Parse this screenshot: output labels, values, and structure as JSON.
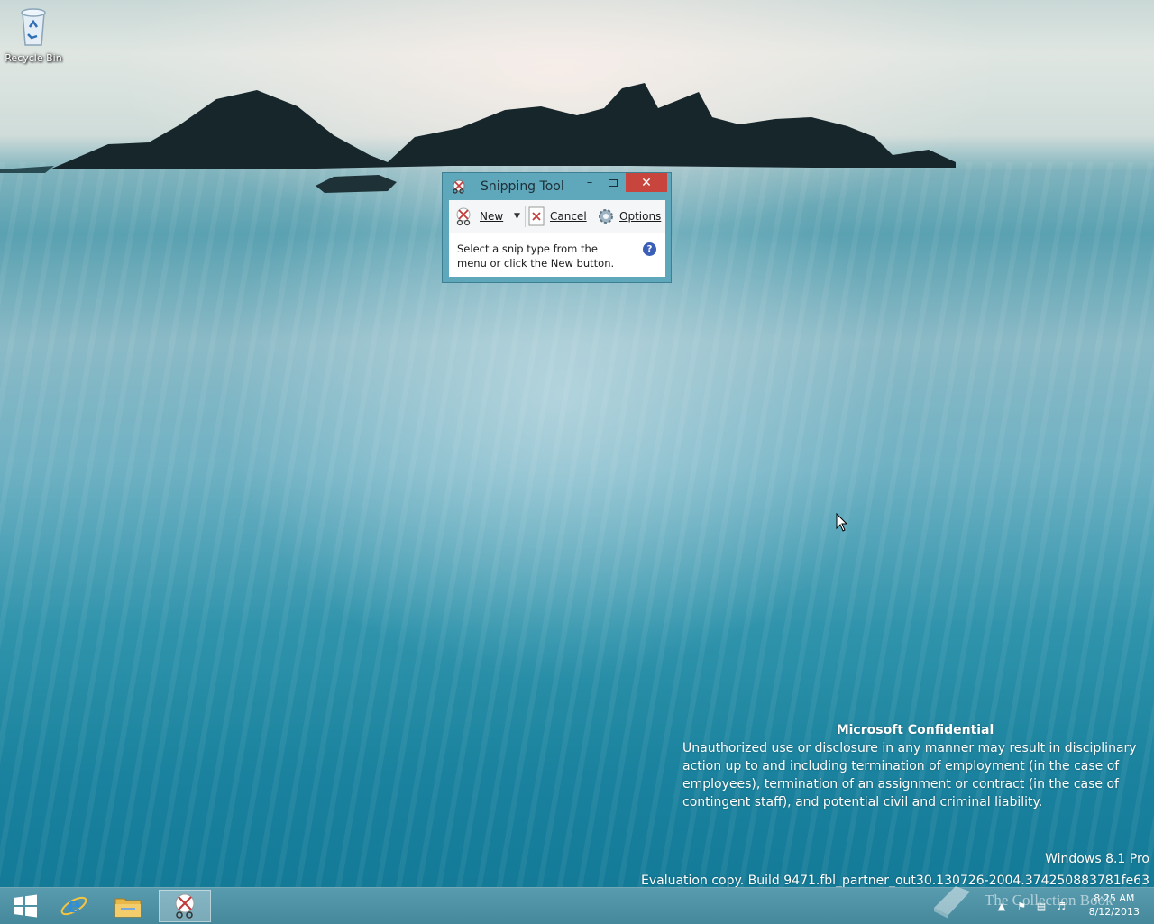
{
  "desktop": {
    "recycle_bin_label": "Recycle Bin"
  },
  "snipping_tool": {
    "title": "Snipping Tool",
    "new_label": "New",
    "cancel_label": "Cancel",
    "options_label": "Options",
    "message": "Select a snip type from the menu or click the New button.",
    "help_glyph": "?"
  },
  "watermark": {
    "heading": "Microsoft Confidential",
    "body": "Unauthorized use or disclosure in any manner may result in disciplinary action up to and including termination of employment (in the case of employees), termination of an assignment or contract (in the case of contingent staff), and potential civil and criminal liability.",
    "edition": "Windows 8.1 Pro",
    "build": "Evaluation copy. Build 9471.fbl_partner_out30.130726-2004.374250883781fe63"
  },
  "taskbar": {
    "time": "8:25 AM",
    "date": "8/12/2013",
    "brand_watermark": "The Collection Book"
  },
  "colors": {
    "close_button": "#c7453d",
    "taskbar": "#4d93a7",
    "help_icon": "#3b5fb7"
  }
}
